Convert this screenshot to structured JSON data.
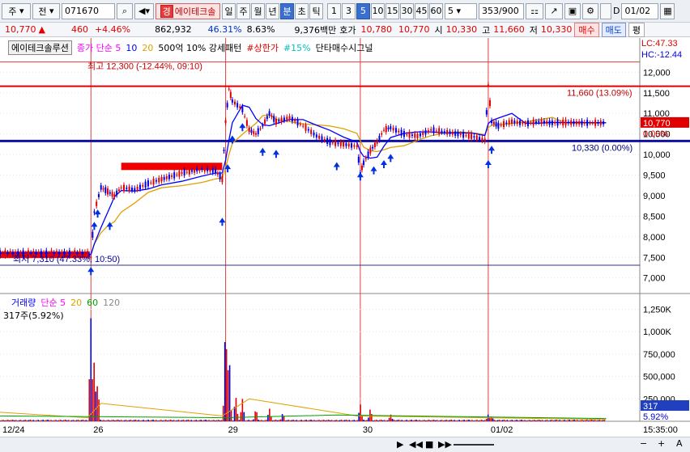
{
  "toolbar": {
    "market": "주",
    "mode": "전",
    "code": "071670",
    "stock_name": "에이테크솔",
    "periods": [
      "일",
      "주",
      "월",
      "년",
      "분",
      "초",
      "틱"
    ],
    "minutes": [
      "1",
      "3",
      "5",
      "10",
      "15",
      "30",
      "45",
      "60"
    ],
    "selected_period": "분",
    "selected_minute": "5",
    "interval_value": "5",
    "count": "353/900",
    "date": "01/02",
    "name_badge": "경"
  },
  "quote": {
    "price": "10,770",
    "change": "460",
    "change_pct": "+4.46%",
    "volume": "862,932",
    "vol_ratio": "46.31%",
    "turnover": "8.63%",
    "amount": "9,376백만",
    "ask_label": "호가",
    "ask": "10,780",
    "bid": "10,770",
    "open_label": "시",
    "open": "10,330",
    "high_label": "고",
    "high": "11,660",
    "low_label": "저",
    "low": "10,330",
    "buy_label": "매수",
    "sell_label": "매도",
    "flat_label": "평"
  },
  "legend": {
    "stock": "에이테크솔루션",
    "ma_title": "종가 단순 5",
    "ma10": "10",
    "ma20": "20",
    "pattern": "500억 10% 강세패턴",
    "upper": "#상한가",
    "pct15": "#15%",
    "signal": "단타매수시그널"
  },
  "annotations": {
    "high": "최고 12,300 (-12.44%, 09:10)",
    "low": "최저 7,310 (47.33%, 10:50)",
    "level_high": "11,660 (13.09%)",
    "level_open": "10,330 (0.00%)"
  },
  "corner": {
    "lc": "LC:47.33",
    "hc": "HC:-12.44"
  },
  "price_tag": {
    "value": "10,770",
    "pct": "0.00%"
  },
  "volume_legend": {
    "title": "거래량",
    "ma": "단순 5",
    "ma20": "20",
    "ma60": "60",
    "ma120": "120",
    "current": "317주(5.92%)"
  },
  "volume_tag": {
    "value": "317",
    "pct": "5.92%"
  },
  "time_tag": "15:35:00",
  "colors": {
    "up": "#e00000",
    "down": "#0000e0",
    "ma5": "#ff00ff",
    "ma10": "#0000ff",
    "ma20": "#e0a000",
    "ma60": "#00a000",
    "ma120": "#888888"
  },
  "chart_data": {
    "type": "candlestick",
    "x_labels": [
      "12/24",
      "26",
      "29",
      "30",
      "01/02"
    ],
    "y_ticks": [
      "12,000",
      "11,500",
      "11,000",
      "10,500",
      "10,000",
      "9,500",
      "9,000",
      "8,500",
      "8,000",
      "7,500",
      "7,000"
    ],
    "vol_ticks": [
      "1,250K",
      "1,000K",
      "750,000",
      "500,000",
      "250,000"
    ],
    "ylim": [
      6700,
      12400
    ],
    "horizontal_lines": [
      {
        "label": "high_pivot",
        "value": 11660
      },
      {
        "label": "open",
        "value": 10330
      },
      {
        "label": "low",
        "value": 7310
      }
    ],
    "price_path": [
      [
        0,
        7600
      ],
      [
        0.13,
        7600
      ],
      [
        0.135,
        7500
      ],
      [
        0.14,
        8600
      ],
      [
        0.15,
        9200
      ],
      [
        0.16,
        9100
      ],
      [
        0.17,
        9000
      ],
      [
        0.18,
        9200
      ],
      [
        0.2,
        9150
      ],
      [
        0.22,
        9300
      ],
      [
        0.24,
        9400
      ],
      [
        0.27,
        9550
      ],
      [
        0.3,
        9650
      ],
      [
        0.32,
        9600
      ],
      [
        0.33,
        9400
      ],
      [
        0.335,
        10800
      ],
      [
        0.34,
        11600
      ],
      [
        0.345,
        11300
      ],
      [
        0.36,
        11100
      ],
      [
        0.37,
        10600
      ],
      [
        0.38,
        10500
      ],
      [
        0.39,
        10700
      ],
      [
        0.4,
        11000
      ],
      [
        0.41,
        10800
      ],
      [
        0.43,
        10900
      ],
      [
        0.45,
        10700
      ],
      [
        0.47,
        10450
      ],
      [
        0.49,
        10300
      ],
      [
        0.51,
        10250
      ],
      [
        0.53,
        10200
      ],
      [
        0.535,
        9550
      ],
      [
        0.54,
        9800
      ],
      [
        0.55,
        10100
      ],
      [
        0.56,
        10300
      ],
      [
        0.57,
        10600
      ],
      [
        0.58,
        10650
      ],
      [
        0.6,
        10500
      ],
      [
        0.62,
        10450
      ],
      [
        0.64,
        10600
      ],
      [
        0.66,
        10550
      ],
      [
        0.68,
        10500
      ],
      [
        0.7,
        10450
      ],
      [
        0.72,
        10350
      ],
      [
        0.725,
        11700
      ],
      [
        0.73,
        10800
      ],
      [
        0.74,
        10700
      ],
      [
        0.76,
        10800
      ],
      [
        0.78,
        10750
      ],
      [
        0.8,
        10800
      ],
      [
        0.82,
        10770
      ],
      [
        0.84,
        10780
      ],
      [
        0.86,
        10770
      ],
      [
        0.88,
        10770
      ],
      [
        0.9,
        10770
      ]
    ],
    "volume_spikes": [
      [
        0.135,
        1150
      ],
      [
        0.14,
        700
      ],
      [
        0.145,
        450
      ],
      [
        0.335,
        1200
      ],
      [
        0.34,
        850
      ],
      [
        0.35,
        300
      ],
      [
        0.36,
        250
      ],
      [
        0.38,
        150
      ],
      [
        0.4,
        150
      ],
      [
        0.42,
        100
      ],
      [
        0.535,
        200
      ],
      [
        0.55,
        150
      ],
      [
        0.58,
        80
      ],
      [
        0.725,
        80
      ],
      [
        0.73,
        60
      ]
    ]
  }
}
